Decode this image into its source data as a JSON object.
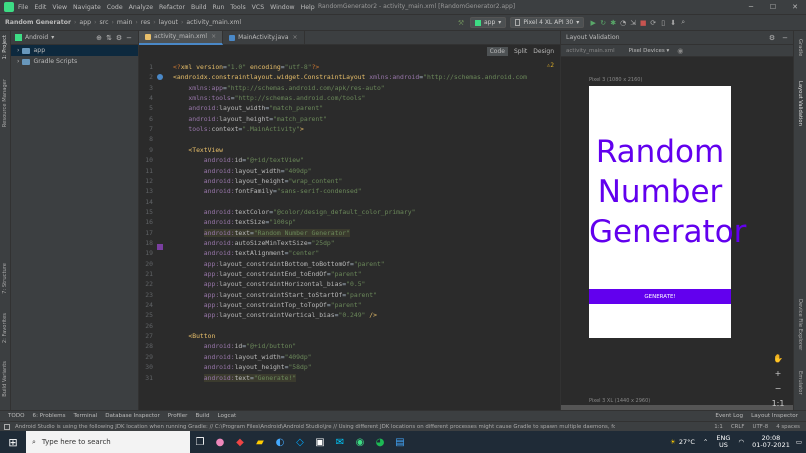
{
  "titlebar": {
    "menu": [
      "File",
      "Edit",
      "View",
      "Navigate",
      "Code",
      "Analyze",
      "Refactor",
      "Build",
      "Run",
      "Tools",
      "VCS",
      "Window",
      "Help"
    ],
    "title": "RandomGenerator2 - activity_main.xml [RandomGenerator2.app]",
    "min": "─",
    "max": "☐",
    "close": "✕"
  },
  "navbar": {
    "crumbs": [
      "Random Generator",
      "app",
      "src",
      "main",
      "res",
      "layout",
      "activity_main.xml"
    ],
    "run_config": "app",
    "device": "Pixel 4 XL API 30"
  },
  "left_strip": {
    "project": "1: Project",
    "resource_manager": "Resource Manager",
    "structure": "7: Structure",
    "favorites": "2: Favorites",
    "build_variants": "Build Variants"
  },
  "right_strip": {
    "gradle": "Gradle",
    "layout_validation": "Layout Validation",
    "device_file_explorer": "Device File Explorer",
    "emulator": "Emulator"
  },
  "project_panel": {
    "view": "Android",
    "items": [
      {
        "label": "app",
        "selected": true
      },
      {
        "label": "Gradle Scripts",
        "selected": false
      }
    ]
  },
  "editor": {
    "tabs": [
      {
        "label": "activity_main.xml",
        "active": true
      },
      {
        "label": "MainActivity.java",
        "active": false
      }
    ],
    "modes": [
      "Code",
      "Split",
      "Design"
    ],
    "inspection": "⚠2",
    "lines": [
      {
        "n": "1",
        "html": "<span class='k'>&lt;?</span><span class='t'>xml version</span>=<span class='s'>\"1.0\"</span> <span class='t'>encoding</span>=<span class='s'>\"utf-8\"</span><span class='k'>?&gt;</span>"
      },
      {
        "n": "2",
        "html": "<span class='t'>&lt;androidx.constraintlayout.widget.ConstraintLayout</span> <span class='ns'>xmlns:android</span>=<span class='s'>\"http://schemas.android.com</span>"
      },
      {
        "n": "3",
        "html": "    <span class='ns'>xmlns:app</span>=<span class='s'>\"http://schemas.android.com/apk/res-auto\"</span>"
      },
      {
        "n": "4",
        "html": "    <span class='ns'>xmlns:tools</span>=<span class='s'>\"http://schemas.android.com/tools\"</span>"
      },
      {
        "n": "5",
        "html": "    <span class='ns'>android:</span><span class='a'>layout_width</span>=<span class='s'>\"match_parent\"</span>"
      },
      {
        "n": "6",
        "html": "    <span class='ns'>android:</span><span class='a'>layout_height</span>=<span class='s'>\"match_parent\"</span>"
      },
      {
        "n": "7",
        "html": "    <span class='ns'>tools:</span><span class='a'>context</span>=<span class='s'>\".MainActivity\"</span><span class='t'>&gt;</span>"
      },
      {
        "n": "8",
        "html": ""
      },
      {
        "n": "9",
        "html": "    <span class='t'>&lt;TextView</span>"
      },
      {
        "n": "10",
        "html": "        <span class='ns'>android:</span><span class='a'>id</span>=<span class='s'>\"@+id/textView\"</span>"
      },
      {
        "n": "11",
        "html": "        <span class='ns'>android:</span><span class='a'>layout_width</span>=<span class='s'>\"409dp\"</span>"
      },
      {
        "n": "12",
        "html": "        <span class='ns'>android:</span><span class='a'>layout_height</span>=<span class='s'>\"wrap_content\"</span>"
      },
      {
        "n": "13",
        "html": "        <span class='ns'>android:</span><span class='a'>fontFamily</span>=<span class='s'>\"sans-serif-condensed\"</span>"
      },
      {
        "n": "14",
        "html": ""
      },
      {
        "n": "15",
        "html": "        <span class='ns'>android:</span><span class='a'>textColor</span>=<span class='s'>\"@color/design_default_color_primary\"</span>"
      },
      {
        "n": "16",
        "html": "        <span class='ns'>android:</span><span class='a'>textSize</span>=<span class='s'>\"100sp\"</span>"
      },
      {
        "n": "17",
        "html": "        <span class='hl'><span class='ns'>android:</span><span class='a'>text</span>=<span class='s'>\"Random Number Generator\"</span></span>"
      },
      {
        "n": "18",
        "html": "        <span class='ns'>android:</span><span class='a'>autoSizeMinTextSize</span>=<span class='s'>\"25dp\"</span>"
      },
      {
        "n": "19",
        "html": "        <span class='ns'>android:</span><span class='a'>textAlignment</span>=<span class='s'>\"center\"</span>"
      },
      {
        "n": "20",
        "html": "        <span class='ns'>app:</span><span class='a'>layout_constraintBottom_toBottomOf</span>=<span class='s'>\"parent\"</span>"
      },
      {
        "n": "21",
        "html": "        <span class='ns'>app:</span><span class='a'>layout_constraintEnd_toEndOf</span>=<span class='s'>\"parent\"</span>"
      },
      {
        "n": "22",
        "html": "        <span class='ns'>app:</span><span class='a'>layout_constraintHorizontal_bias</span>=<span class='s'>\"0.5\"</span>"
      },
      {
        "n": "23",
        "html": "        <span class='ns'>app:</span><span class='a'>layout_constraintStart_toStartOf</span>=<span class='s'>\"parent\"</span>"
      },
      {
        "n": "24",
        "html": "        <span class='ns'>app:</span><span class='a'>layout_constraintTop_toTopOf</span>=<span class='s'>\"parent\"</span>"
      },
      {
        "n": "25",
        "html": "        <span class='ns'>app:</span><span class='a'>layout_constraintVertical_bias</span>=<span class='s'>\"0.249\"</span> <span class='t'>/&gt;</span>"
      },
      {
        "n": "26",
        "html": ""
      },
      {
        "n": "27",
        "html": "    <span class='t'>&lt;Button</span>"
      },
      {
        "n": "28",
        "html": "        <span class='ns'>android:</span><span class='a'>id</span>=<span class='s'>\"@+id/button\"</span>"
      },
      {
        "n": "29",
        "html": "        <span class='ns'>android:</span><span class='a'>layout_width</span>=<span class='s'>\"409dp\"</span>"
      },
      {
        "n": "30",
        "html": "        <span class='ns'>android:</span><span class='a'>layout_height</span>=<span class='s'>\"58dp\"</span>"
      },
      {
        "n": "31",
        "html": "        <span class='hl'><span class='ns'>android:</span><span class='a'>text</span>=<span class='s'>\"Generate!\"</span></span>"
      }
    ]
  },
  "layout_validation": {
    "title": "Layout Validation",
    "file": "activity_main.xml",
    "device_filter": "Pixel Devices ▾",
    "device1_label": "Pixel 3 (1080 x 2160)",
    "device2_label": "Pixel 3 XL (1440 x 2960)",
    "preview_text": "Random Number Generator",
    "preview_button": "GENERATE!",
    "text_color": "#6200ee"
  },
  "tool_windows": [
    "TODO",
    "6: Problems",
    "Terminal",
    "Database Inspector",
    "Profiler",
    "Build",
    "Logcat"
  ],
  "tool_windows_right": [
    "Event Log",
    "Layout Inspector"
  ],
  "status": {
    "message": "Android Studio is using the following JDK location when running Gradle: // C:\\Program Files\\Android\\Android Studio\\jre // Using different JDK locations on different processes might cause Gradle to spawn multiple daemons, for exam... (momen",
    "position": "1:1",
    "line_sep": "CRLF",
    "encoding": "UTF-8",
    "indent": "4 spaces"
  },
  "taskbar": {
    "search_placeholder": "Type here to search",
    "weather": "27°C",
    "lang": "ENG",
    "region": "US",
    "time": "20:08",
    "date": "01-07-2021"
  }
}
